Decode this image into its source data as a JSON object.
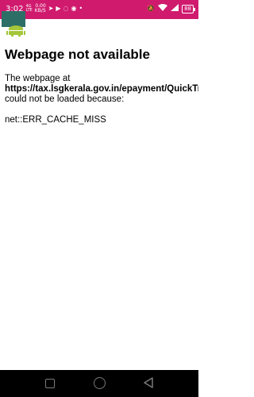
{
  "status_bar": {
    "time": "3:02",
    "network_top": "4G",
    "network_bottom": "LTE",
    "speed_value": "0.00",
    "speed_unit": "KB/S",
    "notification_icons": [
      "telegram-icon",
      "youtube-icon",
      "whatsapp-icon",
      "chrome-icon",
      "dot-icon"
    ],
    "right_icons": [
      "silent-icon",
      "wifi-icon",
      "signal-icon"
    ],
    "battery": "88",
    "background_color": "#d01a6e"
  },
  "error_page": {
    "title": "Webpage not available",
    "intro": "The webpage at",
    "url": "https://tax.lsgkerala.gov.in/epayment/QuickTransaction",
    "reason": "could not be loaded because:",
    "error_code": "net::ERR_CACHE_MISS"
  },
  "nav_bar": {
    "buttons": [
      "recent-apps-button",
      "home-button",
      "back-button"
    ]
  }
}
